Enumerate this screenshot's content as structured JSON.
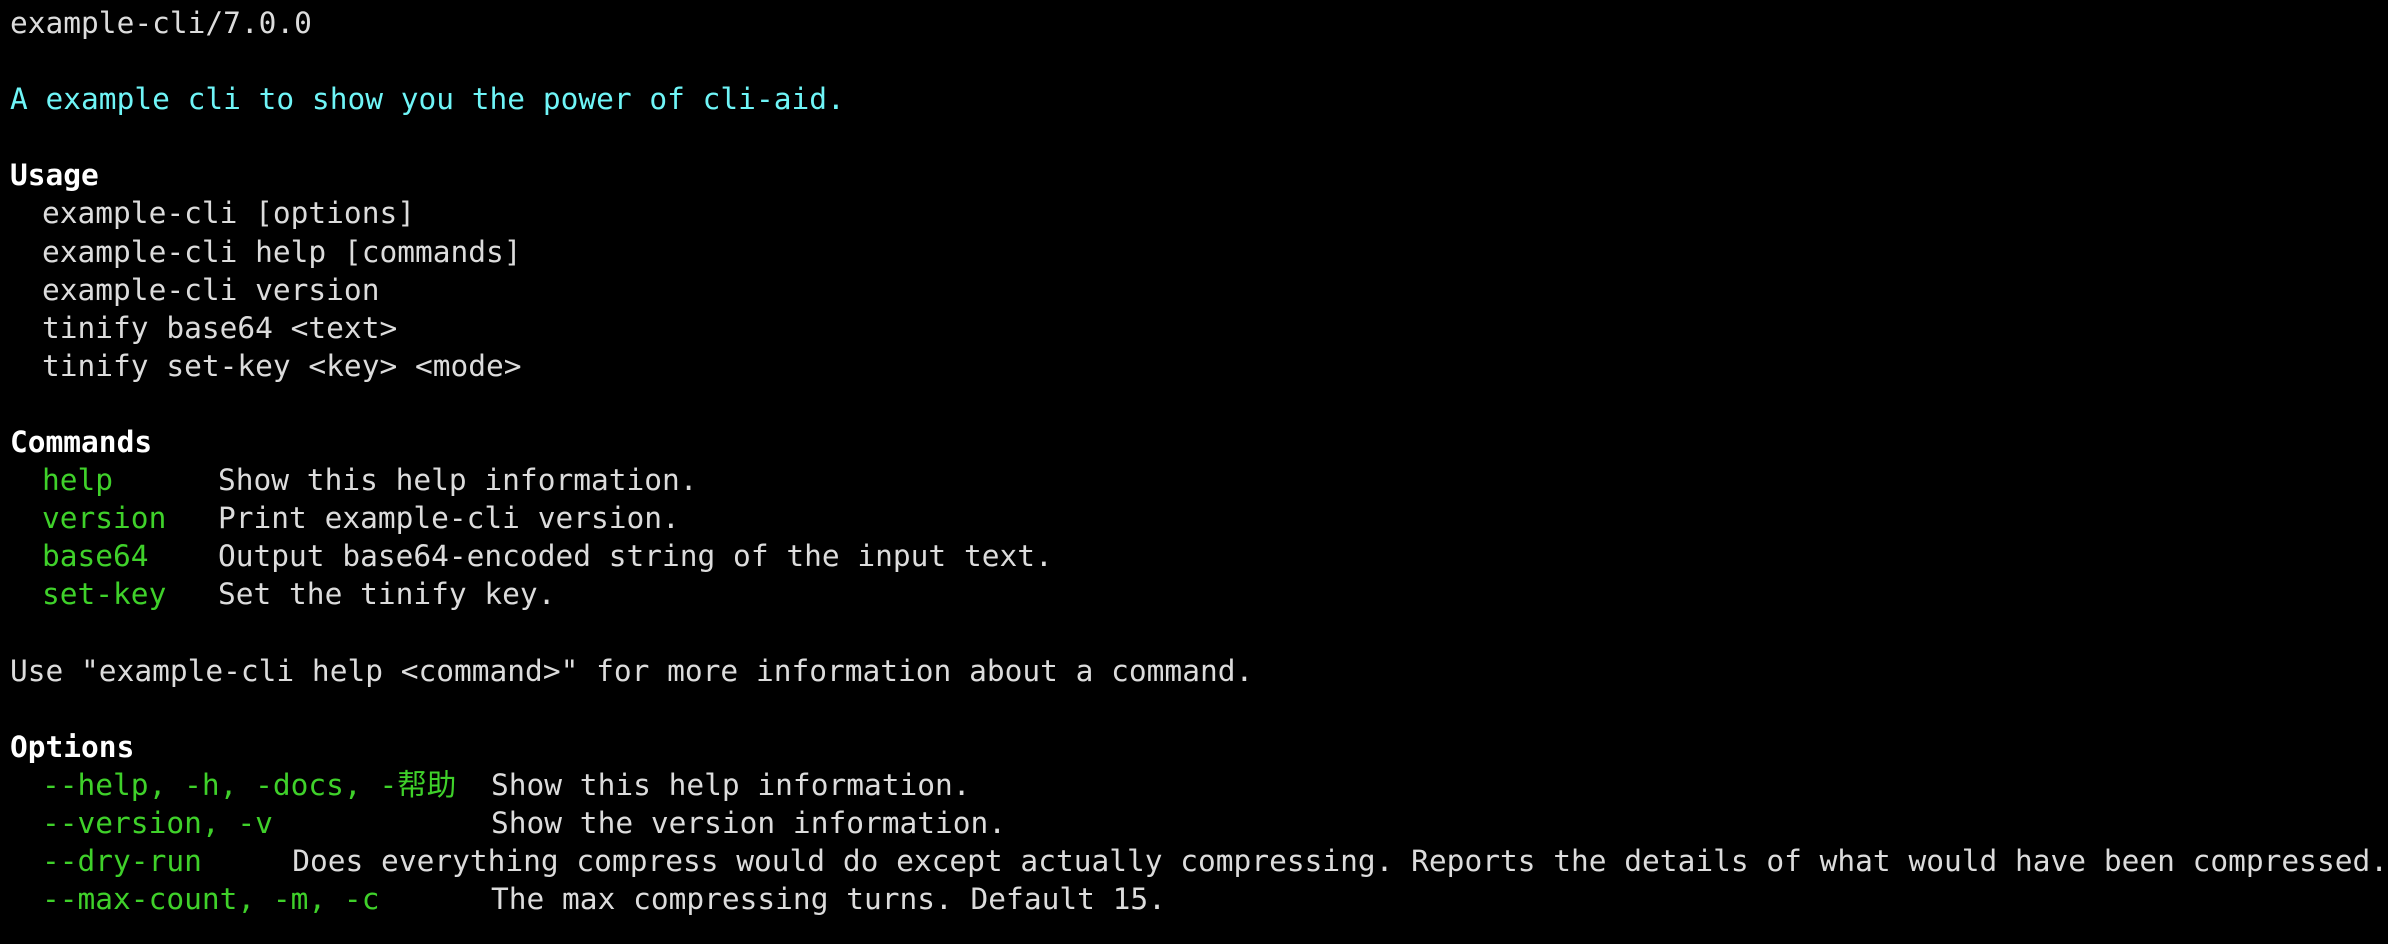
{
  "header": {
    "version_line": "example-cli/7.0.0",
    "description": "A example cli to show you the power of cli-aid."
  },
  "usage": {
    "title": "Usage",
    "lines": [
      "example-cli [options]",
      "example-cli help [commands]",
      "example-cli version",
      "tinify base64 <text>",
      "tinify set-key <key> <mode>"
    ]
  },
  "commands": {
    "title": "Commands",
    "items": [
      {
        "name": "help",
        "desc": "Show this help information."
      },
      {
        "name": "version",
        "desc": "Print example-cli version."
      },
      {
        "name": "base64",
        "desc": "Output base64-encoded string of the input text."
      },
      {
        "name": "set-key",
        "desc": "Set the tinify key."
      }
    ],
    "hint": "Use \"example-cli help <command>\" for more information about a command."
  },
  "options": {
    "title": "Options",
    "items": [
      {
        "name": "--help, -h, -docs, -帮助",
        "desc": "Show this help information."
      },
      {
        "name": "--version, -v",
        "desc": "Show the version information."
      },
      {
        "name": "--dry-run",
        "desc": "Does everything compress would do except actually compressing. Reports the details of what would have been compressed."
      },
      {
        "name": "--max-count, -m, -c",
        "desc": "The max compressing turns. Default 15."
      }
    ]
  },
  "colors": {
    "background": "#000000",
    "text": "#dcdcdc",
    "description": "#6ff5f7",
    "command_name": "#3fd12a",
    "heading": "#ffffff"
  }
}
